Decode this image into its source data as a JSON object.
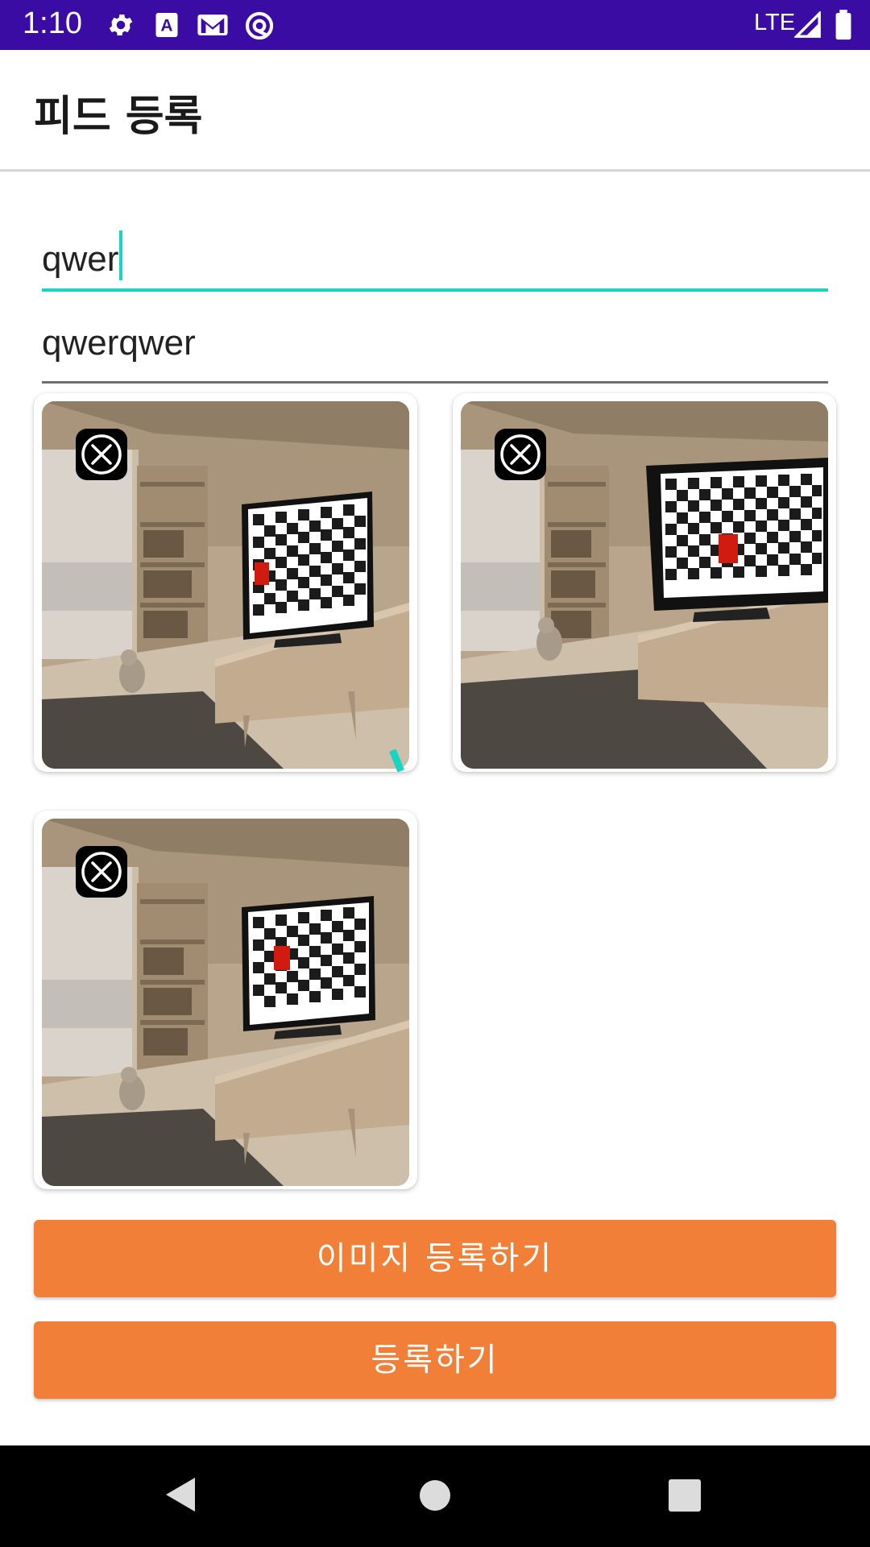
{
  "status_bar": {
    "time": "1:10",
    "network": "LTE",
    "icons": [
      "gear-icon",
      "text-a-icon",
      "gmail-icon",
      "at-sign-icon",
      "signal-icon",
      "battery-icon"
    ],
    "background": "#3a0ca3"
  },
  "app_bar": {
    "title": "피드 등록"
  },
  "form": {
    "title_field": {
      "value": "qwer"
    },
    "content_field": {
      "value": "qwerqwer"
    }
  },
  "images": [
    {
      "remove_icon": "close-icon"
    },
    {
      "remove_icon": "close-icon"
    },
    {
      "remove_icon": "close-icon"
    }
  ],
  "buttons": {
    "add_image_label": "이미지 등록하기",
    "submit_label": "등록하기",
    "color": "#f27f38"
  },
  "nav_bar": {
    "icons": [
      "back-icon",
      "home-icon",
      "recents-icon"
    ]
  },
  "accent_color": "#19d3c5"
}
